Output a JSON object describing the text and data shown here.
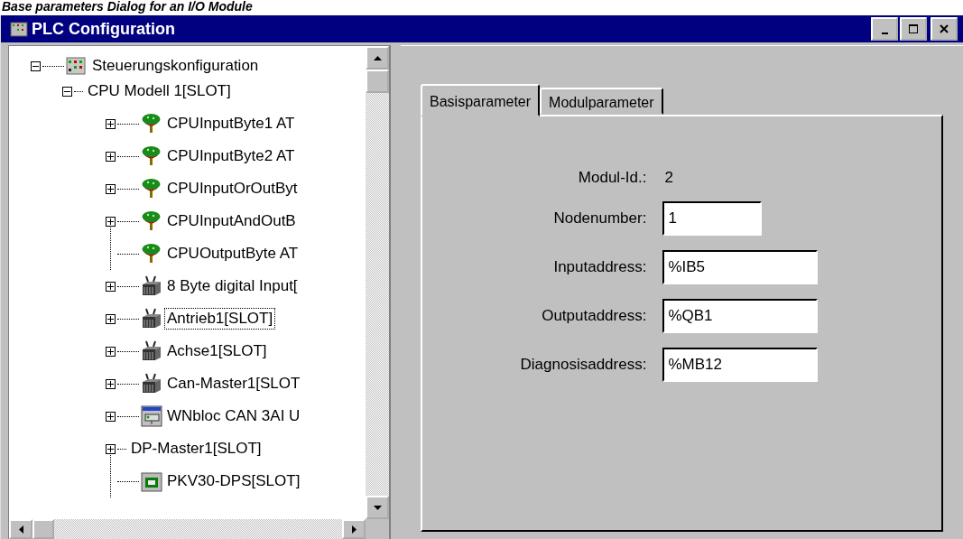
{
  "caption": "Base parameters Dialog for an I/O Module",
  "window": {
    "title": "PLC Configuration"
  },
  "tree": [
    {
      "label": "Steuerungskonfiguration",
      "kind": "rack",
      "expanded": true,
      "selected": false,
      "children": [
        {
          "label": "CPU Modell 1[SLOT]",
          "expanded": true,
          "selected": false,
          "children": [
            {
              "label": "CPUInputByte1  AT",
              "kind": "variable",
              "expanded": false,
              "selected": false
            },
            {
              "label": "CPUInputByte2 AT",
              "kind": "variable",
              "expanded": false,
              "selected": false
            },
            {
              "label": "CPUInputOrOutByt",
              "kind": "variable",
              "expanded": false,
              "selected": false
            },
            {
              "label": "CPUInputAndOutB",
              "kind": "variable",
              "expanded": false,
              "selected": false
            },
            {
              "label": "CPUOutputByte AT",
              "kind": "variable",
              "selected": false
            },
            {
              "label": "8 Byte digital Input[",
              "kind": "module",
              "expanded": false,
              "selected": false
            },
            {
              "label": "Antrieb1[SLOT]",
              "kind": "module",
              "expanded": false,
              "selected": true
            },
            {
              "label": "Achse1[SLOT]",
              "kind": "module",
              "expanded": false,
              "selected": false
            },
            {
              "label": "Can-Master1[SLOT",
              "kind": "module",
              "expanded": false,
              "selected": false
            },
            {
              "label": "WNbloc CAN 3AI U",
              "kind": "bloc",
              "expanded": false,
              "selected": false
            },
            {
              "label": "DP-Master1[SLOT]",
              "expanded": false,
              "selected": false
            },
            {
              "label": "PKV30-DPS[SLOT]",
              "kind": "slave",
              "selected": false
            }
          ]
        }
      ]
    }
  ],
  "tabs": [
    {
      "label": "Basisparameter",
      "selected": true
    },
    {
      "label": "Modulparameter",
      "selected": false
    }
  ],
  "params": [
    {
      "label": "Modul-Id.:",
      "kind": "text",
      "value": "2"
    },
    {
      "label": "Nodenumber:",
      "kind": "short_field",
      "value": "1"
    },
    {
      "label": "Inputaddress:",
      "kind": "field",
      "value": "%IB5"
    },
    {
      "label": "Outputaddress:",
      "kind": "field",
      "value": "%QB1"
    },
    {
      "label": "Diagnosisaddress:",
      "kind": "field",
      "value": "%MB12"
    }
  ]
}
